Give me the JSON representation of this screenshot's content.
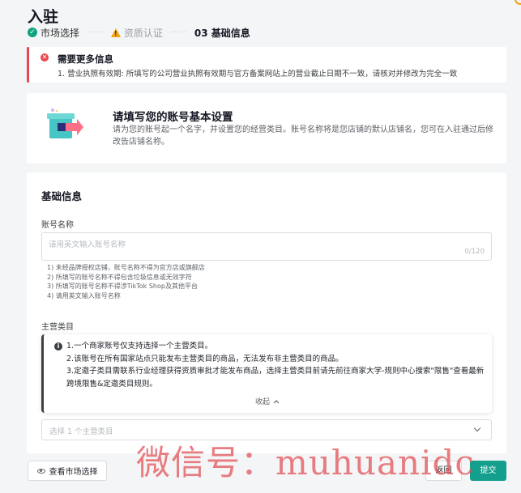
{
  "page": {
    "title": "入驻"
  },
  "steps": [
    {
      "label": "市场选择",
      "status": "done"
    },
    {
      "label": "资质认证",
      "status": "warning"
    },
    {
      "label": "03 基础信息",
      "status": "current"
    }
  ],
  "step_separator": "·····",
  "alert": {
    "title": "需要更多信息",
    "message": "1. 营业执照有效期: 所填写的公司营业执照有效期与官方备案网站上的营业截止日期不一致，请核对并修改为完全一致"
  },
  "intro": {
    "title": "请填写您的账号基本设置",
    "description": "请为您的账号起一个名字，并设置您的经营类目。账号名称将是您店铺的默认店铺名，您可在入驻通过后修改告店铺名称。"
  },
  "form": {
    "section_title": "基础信息",
    "account_name": {
      "label": "账号名称",
      "placeholder": "请用英文输入账号名称",
      "value": "",
      "counter": "0/120",
      "rules": [
        "1) 未经品牌授权店铺，账号名称不得为官方店或旗舰店",
        "2) 所填写的账号名称不得包含垃圾信息或无效字符",
        "3) 所填写的账号名称不得涉TikTok Shop及其他平台",
        "4) 请用英文输入账号名称"
      ]
    },
    "main_category": {
      "label": "主营类目",
      "tips": [
        "1.一个商家账号仅支持选择一个主营类目。",
        "2.该账号在所有国家站点只能发布主营类目的商品，无法发布非主营类目的商品。",
        "3.定邀子类目需联系行业经理获得资质审批才能发布商品，选择主营类目前请先前往商家大学-规则中心搜索\"限售\"查看最新跨境限售&定邀类目规则。"
      ],
      "collapse_label": "收起",
      "placeholder": "选择 1 个主营类目"
    }
  },
  "footer": {
    "view_market_label": "查看市场选择",
    "back_label": "返回",
    "submit_label": "提交"
  },
  "watermark": "微信号：muhuanidc",
  "colors": {
    "accent": "#149f8c",
    "error": "#e5484d",
    "warning": "#f2a20b",
    "success": "#10a37f"
  }
}
